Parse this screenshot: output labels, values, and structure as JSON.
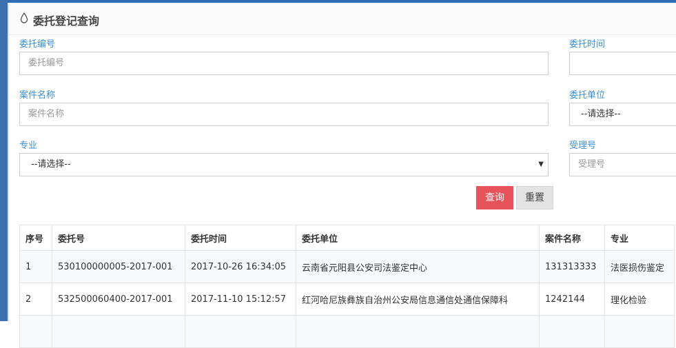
{
  "panel": {
    "title": "委托登记查询",
    "icon": "drop-icon"
  },
  "form": {
    "entrust_no": {
      "label": "委托编号",
      "placeholder": "委托编号"
    },
    "entrust_time": {
      "label": "委托时间",
      "value": ""
    },
    "case_name": {
      "label": "案件名称",
      "placeholder": "案件名称"
    },
    "entrust_unit": {
      "label": "委托单位",
      "selected": "--请选择--"
    },
    "specialty": {
      "label": "专业",
      "selected": "--请选择--"
    },
    "acceptance_no": {
      "label": "受理号",
      "placeholder": "受理号"
    }
  },
  "buttons": {
    "query": "查询",
    "reset": "重置"
  },
  "table": {
    "headers": [
      "序号",
      "委托号",
      "委托时间",
      "委托单位",
      "案件名称",
      "专业"
    ],
    "rows": [
      [
        "1",
        "530100000005-2017-001",
        "2017-10-26 16:34:05",
        "云南省元阳县公安司法鉴定中心",
        "131313333",
        "法医损伤鉴定"
      ],
      [
        "2",
        "532500060400-2017-001",
        "2017-11-10 15:12:57",
        "红河哈尼族彝族自治州公安局信息通信处通信保障科",
        "1242144",
        "理化检验"
      ],
      [
        "",
        "",
        "",
        "",
        "",
        ""
      ]
    ]
  },
  "colors": {
    "accent_label": "#3a8fd0",
    "query_button": "#e8525a",
    "sidebar": "#3a6fb0"
  }
}
